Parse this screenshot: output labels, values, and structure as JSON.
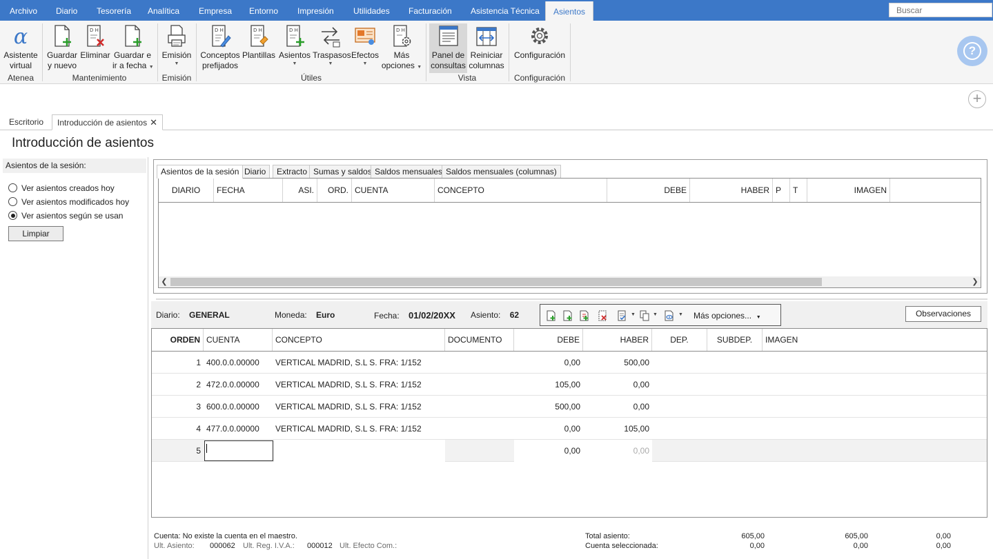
{
  "menu": {
    "items": [
      "Archivo",
      "Diario",
      "Tesorería",
      "Analítica",
      "Empresa",
      "Entorno",
      "Impresión",
      "Utilidades",
      "Facturación",
      "Asistencia Técnica",
      "Asientos"
    ],
    "active": "Asientos"
  },
  "search": {
    "placeholder": "Buscar"
  },
  "ribbon": {
    "asistente": [
      "Asistente",
      "virtual"
    ],
    "guardar_nuevo": [
      "Guardar",
      "y nuevo"
    ],
    "eliminar": "Eliminar",
    "guardar_fecha": [
      "Guardar e",
      "ir a fecha"
    ],
    "emision": "Emisión",
    "conceptos": [
      "Conceptos",
      "prefijados"
    ],
    "plantillas": "Plantillas",
    "asientos": "Asientos",
    "traspasos": "Traspasos",
    "efectos": "Efectos",
    "mas_opciones": [
      "Más",
      "opciones"
    ],
    "panel": [
      "Panel de",
      "consultas"
    ],
    "reiniciar": [
      "Reiniciar",
      "columnas"
    ],
    "configuracion": "Configuración",
    "groups": {
      "atenea": "Atenea",
      "mantenimiento": "Mantenimiento",
      "emision": "Emisión",
      "utiles": "Útiles",
      "vista": "Vista",
      "configuracion": "Configuración"
    }
  },
  "tabs": {
    "escritorio": "Escritorio",
    "introduccion": "Introducción de asientos"
  },
  "page_title": "Introducción de asientos",
  "left_panel": {
    "title": "Asientos de la sesión:",
    "options": [
      "Ver asientos creados hoy",
      "Ver asientos modificados hoy",
      "Ver asientos según se usan"
    ],
    "selected_index": 2,
    "clear_button": "Limpiar"
  },
  "session_tabs": [
    "Asientos de la sesión",
    "Diario",
    "Extracto",
    "Sumas y saldos",
    "Saldos mensuales",
    "Saldos mensuales (columnas)"
  ],
  "top_grid_headers": [
    "DIARIO",
    "FECHA",
    "ASI.",
    "ORD.",
    "CUENTA",
    "CONCEPTO",
    "DEBE",
    "HABER",
    "P",
    "T",
    "IMAGEN"
  ],
  "entry_header": {
    "diario_label": "Diario:",
    "diario_value": "GENERAL",
    "moneda_label": "Moneda:",
    "moneda_value": "Euro",
    "fecha_label": "Fecha:",
    "fecha_value": "01/02/20XX",
    "asiento_label": "Asiento:",
    "asiento_value": "62",
    "mas_opciones": "Más opciones...",
    "observaciones": "Observaciones"
  },
  "entry_grid": {
    "headers": [
      "ORDEN",
      "CUENTA",
      "CONCEPTO",
      "DOCUMENTO",
      "DEBE",
      "HABER",
      "DEP.",
      "SUBDEP.",
      "IMAGEN"
    ],
    "rows": [
      {
        "orden": "1",
        "cuenta": "400.0.0.00000",
        "concepto": "VERTICAL MADRID, S.L S. FRA:  1/152",
        "documento": "",
        "debe": "0,00",
        "haber": "500,00"
      },
      {
        "orden": "2",
        "cuenta": "472.0.0.00000",
        "concepto": "VERTICAL MADRID, S.L S. FRA:  1/152",
        "documento": "",
        "debe": "105,00",
        "haber": "0,00"
      },
      {
        "orden": "3",
        "cuenta": "600.0.0.00000",
        "concepto": "VERTICAL MADRID, S.L S. FRA:  1/152",
        "documento": "",
        "debe": "500,00",
        "haber": "0,00"
      },
      {
        "orden": "4",
        "cuenta": "477.0.0.00000",
        "concepto": "VERTICAL MADRID, S.L S. FRA:  1/152",
        "documento": "",
        "debe": "0,00",
        "haber": "105,00"
      }
    ],
    "edit_row": {
      "orden": "5",
      "cuenta": "",
      "debe": "0,00",
      "haber": "0,00"
    }
  },
  "footer": {
    "message": "Cuenta: No existe la cuenta en el maestro.",
    "ult_asiento_label": "Ult. Asiento:",
    "ult_asiento_value": "000062",
    "ult_iva_label": "Ult. Reg. I.V.A.:",
    "ult_iva_value": "000012",
    "ult_efecto_label": "Ult. Efecto Com.:",
    "total_label": "Total asiento:",
    "total_debe": "605,00",
    "total_haber": "605,00",
    "total_saldo": "0,00",
    "cuenta_sel_label": "Cuenta seleccionada:",
    "sel_debe": "0,00",
    "sel_haber": "0,00",
    "sel_saldo": "0,00"
  }
}
